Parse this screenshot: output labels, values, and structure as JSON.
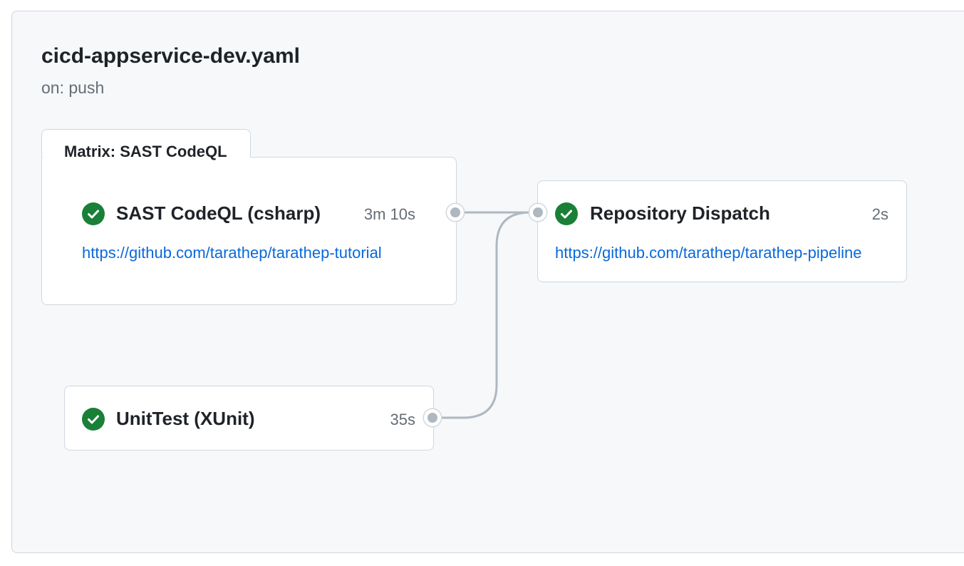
{
  "workflow": {
    "title": "cicd-appservice-dev.yaml",
    "trigger": "on: push"
  },
  "matrix": {
    "label": "Matrix: SAST CodeQL"
  },
  "jobs": {
    "sast": {
      "name": "SAST CodeQL (csharp)",
      "duration": "3m 10s",
      "link": "https://github.com/tarathep/tarathep-tutorial",
      "status": "success"
    },
    "dispatch": {
      "name": "Repository Dispatch",
      "duration": "2s",
      "link": "https://github.com/tarathep/tarathep-pipeline",
      "status": "success"
    },
    "unittest": {
      "name": "UnitTest (XUnit)",
      "duration": "35s",
      "status": "success"
    }
  },
  "colors": {
    "success": "#1a7f37",
    "link": "#0969da",
    "connector": "#afb8c1"
  },
  "icons": {
    "status": "check-circle-icon"
  }
}
